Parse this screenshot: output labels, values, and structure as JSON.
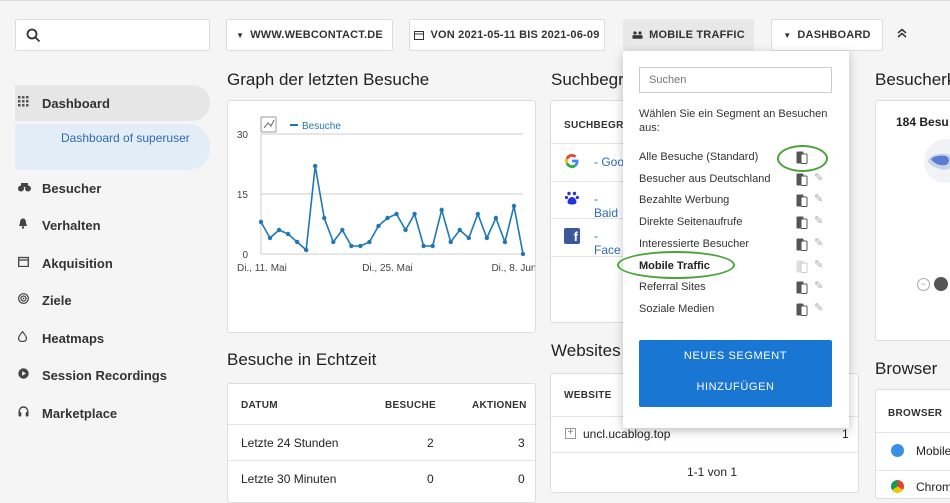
{
  "header": {
    "search_placeholder": "",
    "site_button": "WWW.WEBCONTACT.DE",
    "date_button": "VON 2021-05-11 BIS 2021-06-09",
    "segment_button": "MOBILE TRAFFIC",
    "dashboard_button": "DASHBOARD"
  },
  "sidebar": {
    "items": [
      {
        "label": "Dashboard",
        "icon": "grid-icon"
      },
      {
        "label": "Besucher",
        "icon": "binoculars-icon"
      },
      {
        "label": "Verhalten",
        "icon": "bell-icon"
      },
      {
        "label": "Akquisition",
        "icon": "calendar-icon"
      },
      {
        "label": "Ziele",
        "icon": "target-icon"
      },
      {
        "label": "Heatmaps",
        "icon": "flame-icon"
      },
      {
        "label": "Session Recordings",
        "icon": "play-icon"
      },
      {
        "label": "Marketplace",
        "icon": "headphones-icon"
      }
    ],
    "sub_item": "Dashboard of superuser"
  },
  "graph_widget": {
    "title": "Graph der letzten Besuche",
    "legend": "Besuche"
  },
  "chart_data": {
    "type": "line",
    "series": [
      {
        "name": "Besuche",
        "values": [
          8,
          4,
          6,
          5,
          3,
          1,
          22,
          9,
          3,
          6,
          2,
          2,
          3,
          7,
          9,
          10,
          6,
          10,
          2,
          2,
          11,
          3,
          6,
          4,
          10,
          4,
          9,
          3,
          12,
          0
        ]
      }
    ],
    "x_tick_labels": [
      "Di., 11. Mai",
      "Di., 25. Mai",
      "Di., 8. Jun"
    ],
    "y_tick_labels": [
      "30",
      "15",
      "0"
    ],
    "ylim": [
      0,
      30
    ],
    "color": "#1f78b4",
    "grid": true
  },
  "search_widget": {
    "title": "Suchbegr",
    "header": "SUCHBEGRI",
    "engines": [
      {
        "name": "- Goo",
        "icon": "google-icon"
      },
      {
        "name": "- Baid",
        "icon": "baidu-icon"
      },
      {
        "name": "- Face",
        "icon": "facebook-icon"
      }
    ]
  },
  "realtime_widget": {
    "title": "Besuche in Echtzeit",
    "columns": [
      "DATUM",
      "BESUCHE",
      "AKTIONEN"
    ],
    "rows": [
      {
        "label": "Letzte 24 Stunden",
        "visits": "2",
        "actions": "3"
      },
      {
        "label": "Letzte 30 Minuten",
        "visits": "0",
        "actions": "0"
      }
    ]
  },
  "websites_widget": {
    "title": "Websites",
    "header": "WEBSITE",
    "row_site": "uncl.ucablog.top",
    "row_value": "1",
    "pagination": "1-1 von 1"
  },
  "right_widgets": {
    "map_title": "Besucherk",
    "map_label": "184 Besu",
    "browser_title": "Browser",
    "browser_header": "BROWSER",
    "browsers": [
      "Mobile",
      "Chrom"
    ]
  },
  "segment_popup": {
    "search_placeholder": "Suchen",
    "intro": "Wählen Sie ein Segment an Besuchen aus:",
    "segments": [
      "Alle Besuche (Standard)",
      "Besucher aus Deutschland",
      "Bezahlte Werbung",
      "Direkte Seitenaufrufe",
      "Interessierte Besucher",
      "Mobile Traffic",
      "Referral Sites",
      "Soziale Medien"
    ],
    "new_segment_line1": "NEUES SEGMENT",
    "new_segment_line2": "HINZUFÜGEN",
    "highlight_color": "#4aa33a"
  }
}
